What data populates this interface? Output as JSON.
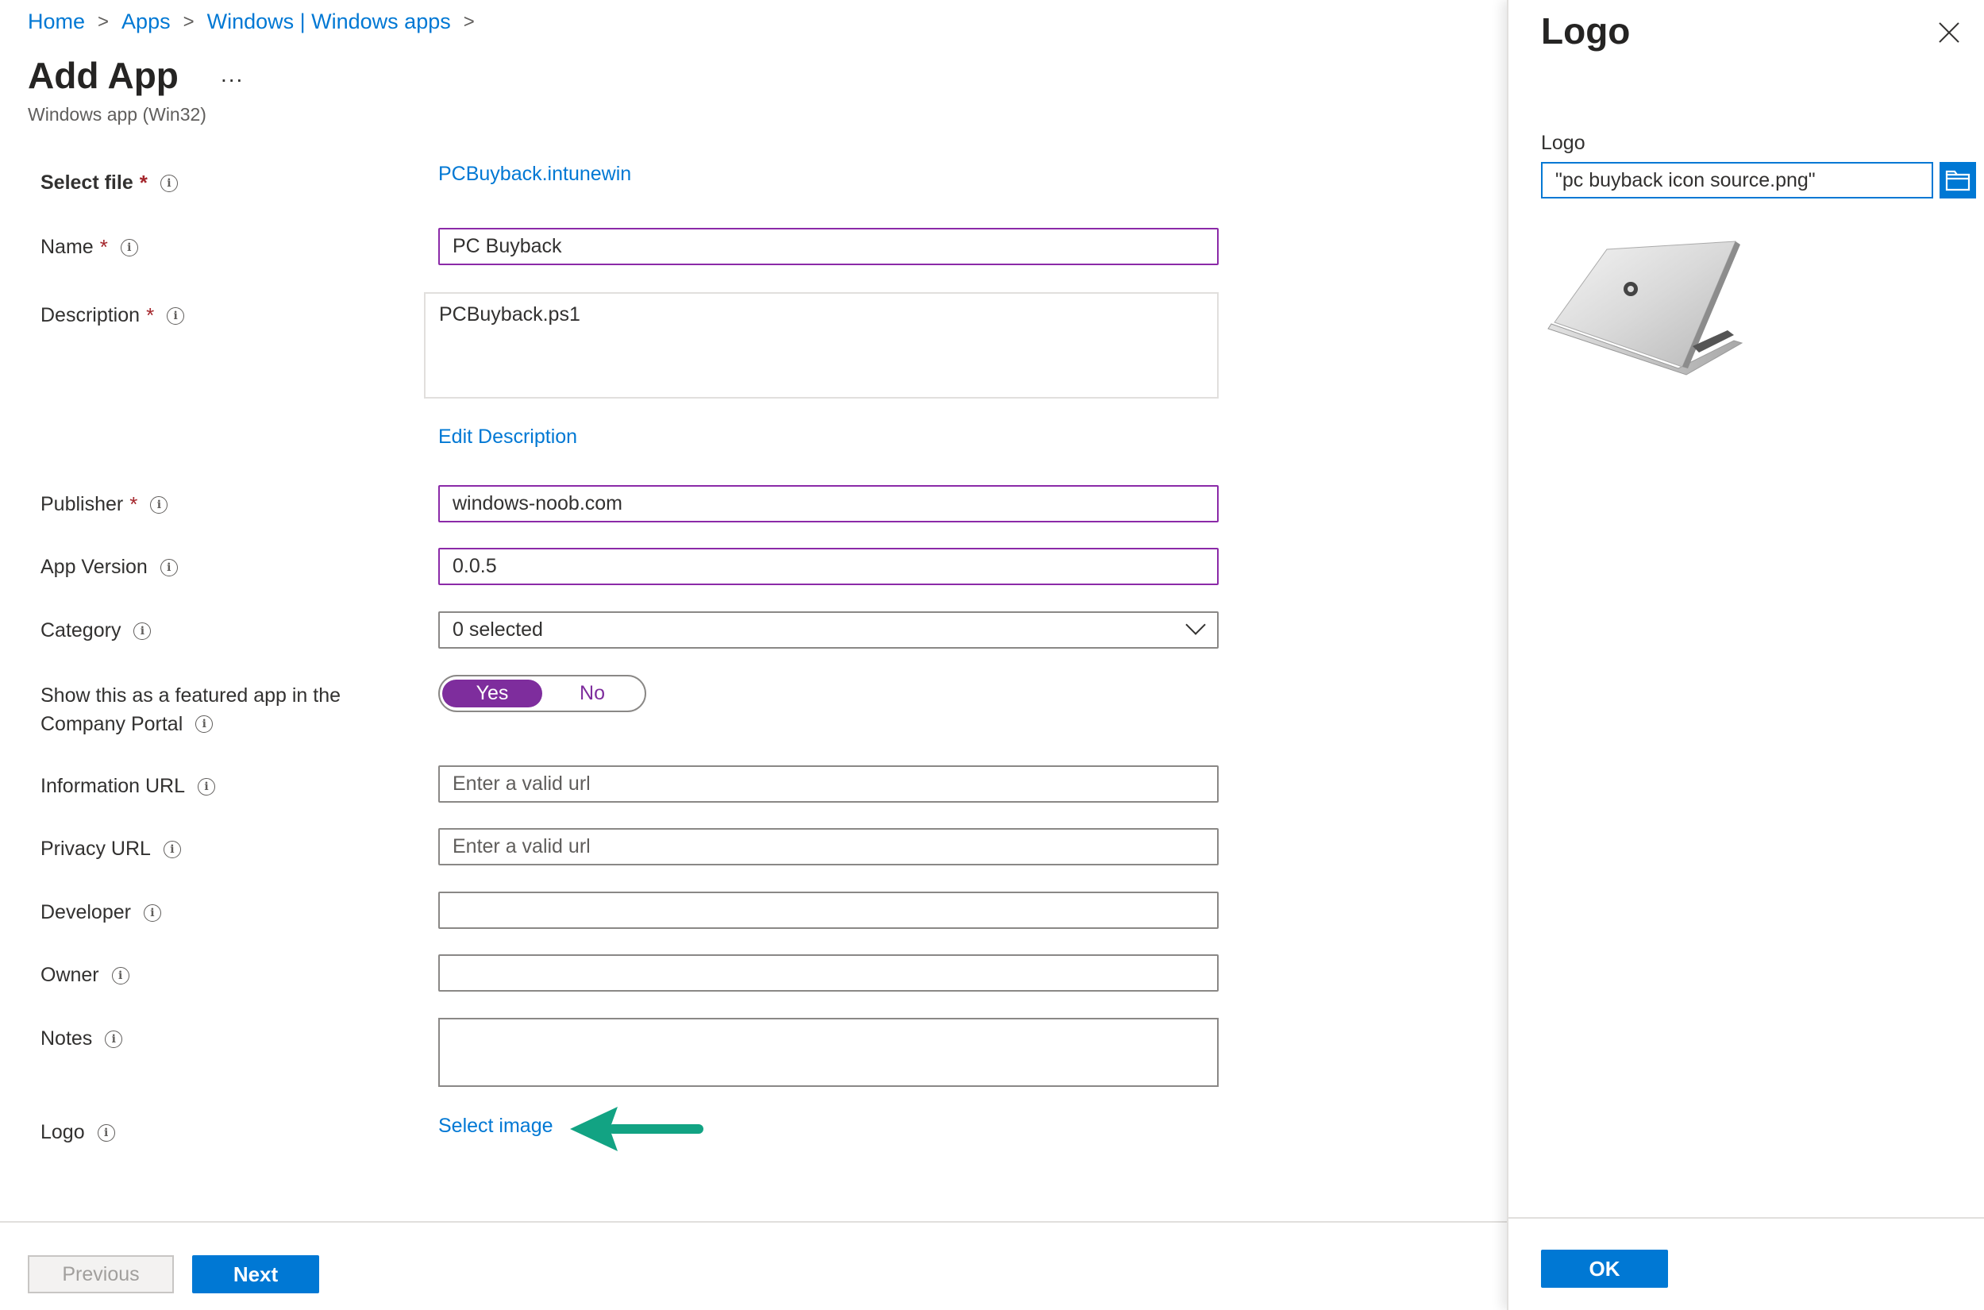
{
  "breadcrumb": {
    "items": [
      "Home",
      "Apps",
      "Windows | Windows apps"
    ],
    "separator": ">"
  },
  "header": {
    "title": "Add App",
    "more": "...",
    "subtitle": "Windows app (Win32)"
  },
  "form": {
    "select_file": {
      "label": "Select file",
      "value": "PCBuyback.intunewin"
    },
    "name": {
      "label": "Name",
      "value": "PC Buyback"
    },
    "description": {
      "label": "Description",
      "value": "PCBuyback.ps1",
      "edit_link": "Edit Description"
    },
    "publisher": {
      "label": "Publisher",
      "value": "windows-noob.com"
    },
    "app_version": {
      "label": "App Version",
      "value": "0.0.5"
    },
    "category": {
      "label": "Category",
      "value": "0 selected"
    },
    "featured": {
      "label_line1": "Show this as a featured app in the",
      "label_line2": "Company Portal",
      "yes": "Yes",
      "no": "No",
      "selected": "Yes"
    },
    "information_url": {
      "label": "Information URL",
      "placeholder": "Enter a valid url"
    },
    "privacy_url": {
      "label": "Privacy URL",
      "placeholder": "Enter a valid url"
    },
    "developer": {
      "label": "Developer",
      "value": ""
    },
    "owner": {
      "label": "Owner",
      "value": ""
    },
    "notes": {
      "label": "Notes",
      "value": ""
    },
    "logo": {
      "label": "Logo",
      "link": "Select image"
    },
    "required_marker": "*",
    "info_icon": "i"
  },
  "footer": {
    "previous": "Previous",
    "next": "Next"
  },
  "panel": {
    "title": "Logo",
    "field_label": "Logo",
    "file_value": "\"pc buyback icon source.png\"",
    "ok": "OK"
  },
  "colors": {
    "accent": "#0078d4",
    "toggle_on": "#7e2d9d",
    "active_border": "#8b2aa8",
    "arrow": "#12a383",
    "required": "#a4262c"
  }
}
